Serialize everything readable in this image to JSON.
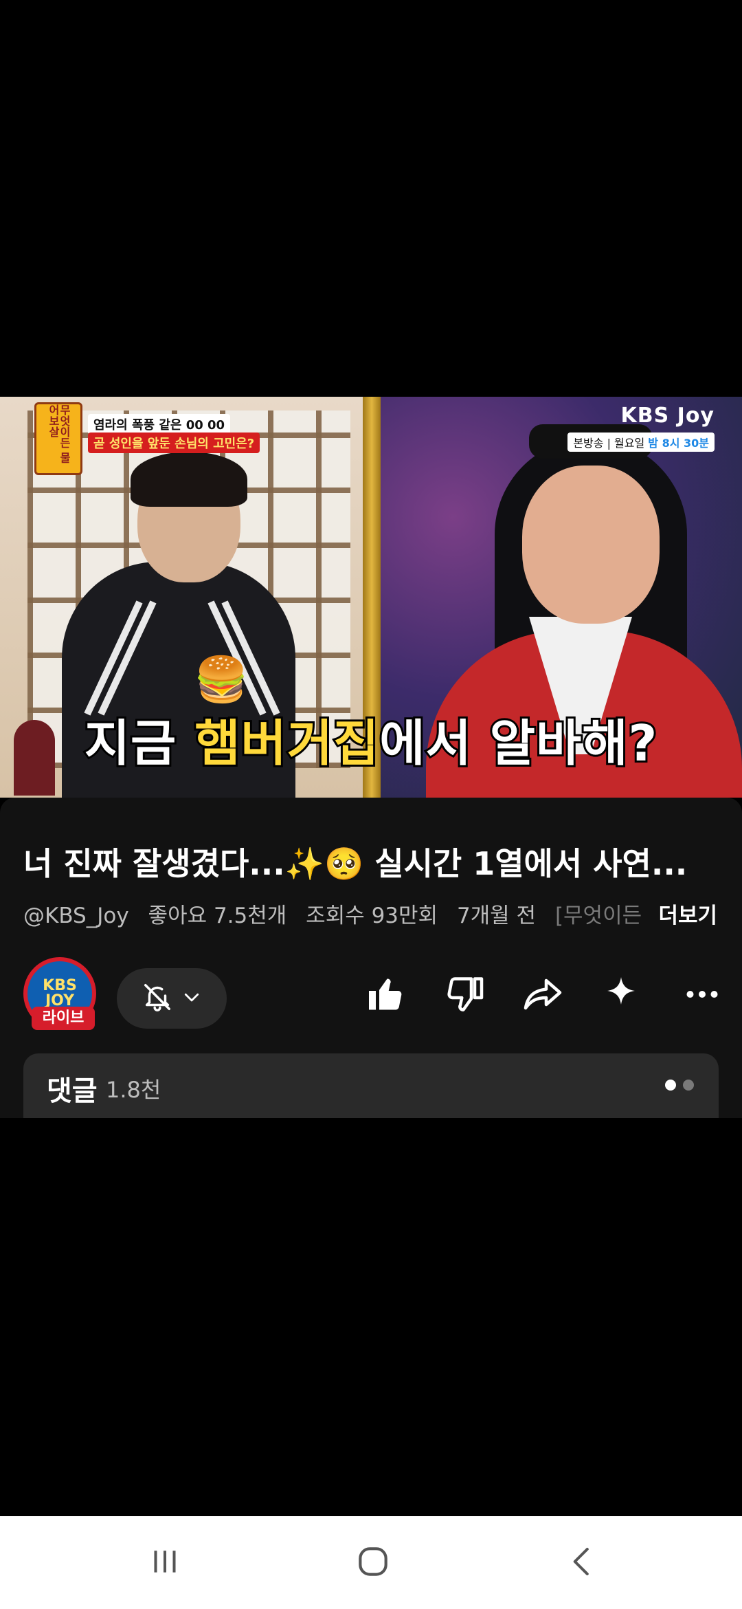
{
  "video": {
    "show_badge": "무엇이든 물어보살",
    "caption_top": "염라의 폭풍 같은 00 00",
    "caption_bottom": "곧 성인을 앞둔 손님의 고민은?",
    "channel_brand": "KBS Joy",
    "broadcast_info_prefix": "본방송 | 월요일 ",
    "broadcast_info_time": "밤 8시 30분",
    "subtitle_part1": "지금 ",
    "subtitle_highlight": "햄버거집",
    "subtitle_part2": "에서 알바해?"
  },
  "info": {
    "title": "너 진짜 잘생겼다...✨🥺 실시간 1열에서 사연...",
    "handle": "@KBS_Joy",
    "likes": "좋아요 7.5천개",
    "views": "조회수 93만회",
    "age": "7개월 전",
    "desc_snippet": "[무엇이든",
    "more_label": "더보기"
  },
  "channel": {
    "avatar_text": "KBS JOY",
    "live_label": "라이브"
  },
  "actions": {
    "icons": [
      "bell-off-icon",
      "chevron-down-icon",
      "thumbs-up-icon",
      "thumbs-down-icon",
      "share-icon",
      "sparkle-icon",
      "more-icon"
    ]
  },
  "comments": {
    "label": "댓글",
    "count": "1.8천"
  },
  "colors": {
    "subtitle_highlight": "#ffd93b",
    "live_badge": "#d61d2b",
    "panel_bg": "#121212"
  }
}
